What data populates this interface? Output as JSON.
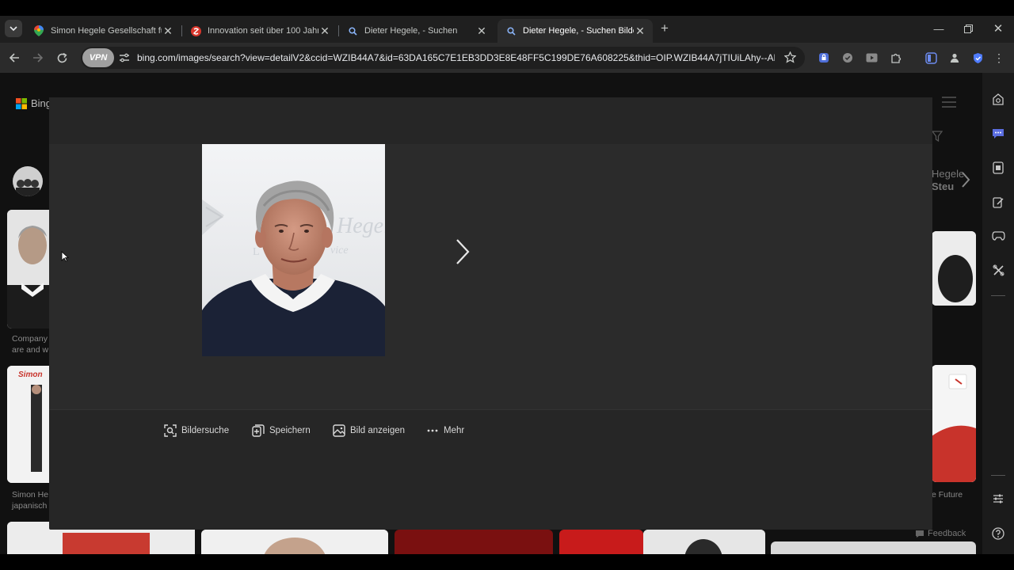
{
  "browser": {
    "tabs": [
      {
        "title": "Simon Hegele Gesellschaft für l",
        "active": false
      },
      {
        "title": "Innovation seit über 100 Jahren",
        "active": false
      },
      {
        "title": "Dieter Hegele, - Suchen",
        "active": false
      },
      {
        "title": "Dieter Hegele, - Suchen Bilder",
        "active": true
      }
    ],
    "new_tab_label": "+",
    "vpn_label": "VPN",
    "url": "bing.com/images/search?view=detailV2&ccid=WZIB44A7&id=63DA165C7E1EB3DD3E8E48FF5C199DE76A608225&thid=OIP.WZIB44A7jTIUiLAhy--ARwAA..."
  },
  "page": {
    "logo_text": "Bing",
    "bg_related_name_right": "Hegele",
    "bg_related_sub_right": "Steu",
    "bg_caption_left_1": "Company",
    "bg_caption_left_2": "are and w",
    "bg_caption_left_3": "Simon He",
    "bg_caption_left_4": "japanisch",
    "bg_caption_right": "e Future",
    "bg_thumb_brand": "Simon",
    "feedback_label": "Feedback"
  },
  "viewer": {
    "actions": [
      {
        "label": "Bildersuche",
        "icon": "visual-search-icon"
      },
      {
        "label": "Speichern",
        "icon": "save-collection-icon"
      },
      {
        "label": "Bild anzeigen",
        "icon": "view-image-icon"
      },
      {
        "label": "Mehr",
        "icon": "more-dots-icon"
      }
    ],
    "photo_bg_text_1": "Hegel",
    "photo_bg_text_2": "L",
    "photo_bg_text_3": "vice"
  },
  "colors": {
    "page_bg": "#111111",
    "modal_bg": "#262626",
    "modal_main_bg": "#2b2b2b",
    "tab_active_bg": "#2b2b2b",
    "sidebar_accent": "#5b6ee1"
  }
}
